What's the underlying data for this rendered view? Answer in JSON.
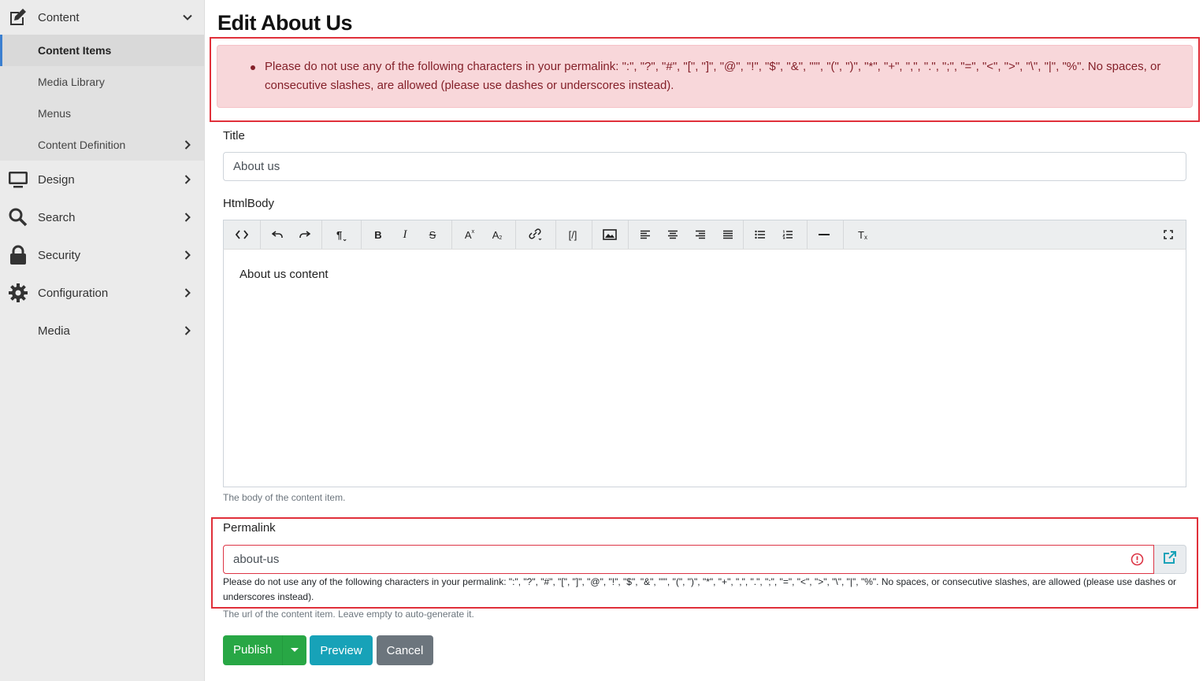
{
  "sidebar": {
    "content": "Content",
    "sub_items": [
      "Content Items",
      "Media Library",
      "Menus",
      "Content Definition"
    ],
    "items": [
      "Design",
      "Search",
      "Security",
      "Configuration",
      "Media"
    ]
  },
  "page": {
    "title": "Edit About Us",
    "alert_message": "Please do not use any of the following characters in your permalink: \":\", \"?\", \"#\", \"[\", \"]\", \"@\", \"!\", \"$\", \"&\", \"'\", \"(\", \")\", \"*\", \"+\", \",\", \".\", \";\", \"=\", \"<\", \">\", \"\\\", \"|\", \"%\". No spaces, or consecutive slashes, are allowed (please use dashes or underscores instead)."
  },
  "form": {
    "title_label": "Title",
    "title_value": "About us",
    "htmlbody_label": "HtmlBody",
    "editor_content": "About us content",
    "htmlbody_help": "The body of the content item.",
    "permalink_label": "Permalink",
    "permalink_value": "about-us",
    "permalink_error": "Please do not use any of the following characters in your permalink: \":\", \"?\", \"#\", \"[\", \"]\", \"@\", \"!\", \"$\", \"&\", \"'\", \"(\", \")\", \"*\", \"+\", \",\", \".\", \";\", \"=\", \"<\", \">\", \"\\\", \"|\", \"%\". No spaces, or consecutive slashes, are allowed (please use dashes or underscores instead).",
    "permalink_help": "The url of the content item. Leave empty to auto-generate it."
  },
  "toolbar": {
    "paragraph": "¶",
    "bold": "B",
    "italic": "I",
    "strikethrough": "S",
    "superscript": "A",
    "subscript": "A",
    "code": "[/]",
    "clear_format": "T"
  },
  "buttons": {
    "publish": "Publish",
    "preview": "Preview",
    "cancel": "Cancel"
  },
  "colors": {
    "alert_bg": "#f8d7da",
    "alert_text": "#842029",
    "highlight": "#e0303a",
    "publish": "#28a745",
    "preview": "#17a2b8",
    "cancel": "#6c757d",
    "error": "#dc3545",
    "link_accent": "#17a2b8"
  },
  "icons": [
    "edit-icon",
    "chevron-down-icon",
    "chevron-right-icon",
    "monitor-icon",
    "search-icon",
    "lock-icon",
    "gear-icon",
    "source-code-icon",
    "undo-icon",
    "redo-icon",
    "link-icon",
    "image-icon",
    "align-left-icon",
    "align-center-icon",
    "align-right-icon",
    "align-justify-icon",
    "bullet-list-icon",
    "numbered-list-icon",
    "horizontal-rule-icon",
    "fullscreen-icon",
    "error-icon",
    "external-link-icon"
  ]
}
